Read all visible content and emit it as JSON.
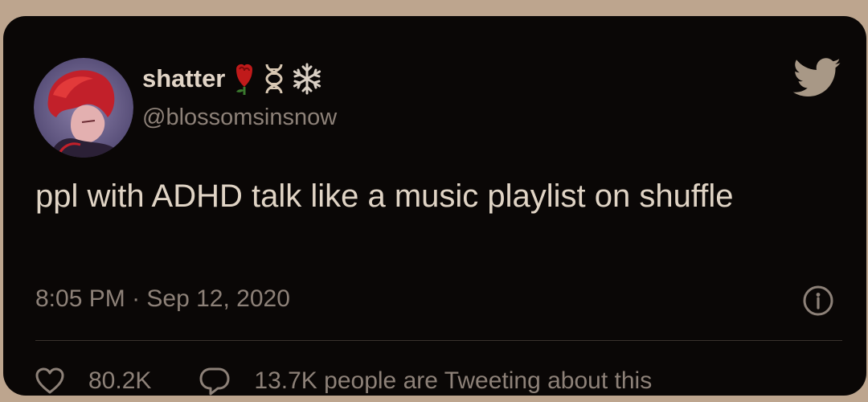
{
  "tweet": {
    "author": {
      "display_name": "shatter",
      "name_emojis": [
        "rose-icon",
        "dna-icon",
        "snowflake-icon"
      ],
      "handle": "@blossomsinsnow",
      "avatar": "red-haired-character-avatar"
    },
    "text": "ppl with ADHD talk like a music playlist on shuffle",
    "time": "8:05 PM",
    "separator": " · ",
    "date": "Sep 12, 2020",
    "likes": "80.2K",
    "conversation": "13.7K people are Tweeting about this",
    "icons": {
      "brand": "twitter-bird-icon",
      "info": "info-icon",
      "like": "heart-icon",
      "reply": "speech-bubble-icon"
    }
  },
  "colors": {
    "background": "#bda58e",
    "card": "#0a0706",
    "primary_text": "#e0d4c5",
    "secondary_text": "#8d8178",
    "accent": "#a89886"
  }
}
